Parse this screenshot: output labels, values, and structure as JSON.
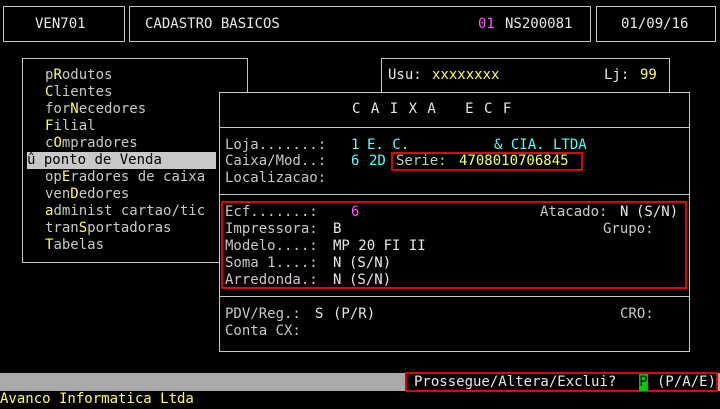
{
  "header": {
    "program_code": "VEN701",
    "title": "CADASTRO BASICOS",
    "company_num": "01",
    "workstation": "NS200081",
    "date": "01/09/16"
  },
  "userbar": {
    "user_label": "Usu:",
    "user_value": "xxxxxxxx",
    "store_label": "Lj:",
    "store_value": "99"
  },
  "menu": {
    "items": [
      {
        "pre": "p",
        "hot": "R",
        "post": "odutos"
      },
      {
        "pre": "",
        "hot": "C",
        "post": "lientes"
      },
      {
        "pre": "for",
        "hot": "N",
        "post": "ecedores"
      },
      {
        "pre": "",
        "hot": "F",
        "post": "ilial"
      },
      {
        "pre": "c",
        "hot": "O",
        "post": "mpradores"
      },
      {
        "pre": "û ",
        "hot": "p",
        "post": "onto de Venda"
      },
      {
        "pre": "op",
        "hot": "E",
        "post": "radores de caixa"
      },
      {
        "pre": "ven",
        "hot": "D",
        "post": "edores"
      },
      {
        "pre": "",
        "hot": "a",
        "post": "dminist cartao/tic"
      },
      {
        "pre": "tran",
        "hot": "S",
        "post": "portadoras"
      },
      {
        "pre": "",
        "hot": "T",
        "post": "abelas"
      }
    ]
  },
  "dialog": {
    "title": "C A I X A   E C F",
    "loja_label": "Loja.......:",
    "loja_num": "1",
    "loja_name": "E. C.",
    "loja_name2": "& CIA. LTDA",
    "caixa_label": "Caixa/Mod..:",
    "caixa_num": "6",
    "caixa_mod": "2D",
    "serie_label": "Serie:",
    "serie_value": "4708010706845",
    "localizacao_label": "Localizacao:",
    "ecf_label": "Ecf.......:",
    "ecf_value": "6",
    "atacado_label": "Atacado:",
    "atacado_value": "N",
    "atacado_hint": "(S/N)",
    "impressora_label": "Impressora:",
    "impressora_value": "B",
    "grupo_label": "Grupo:",
    "modelo_label": "Modelo....:",
    "modelo_value": "MP 20 FI II",
    "soma_label": "Soma 1....:",
    "soma_value": "N",
    "soma_hint": "(S/N)",
    "arredonda_label": "Arredonda.:",
    "arredonda_value": "N",
    "arredonda_hint": "(S/N)",
    "pdv_label": "PDV/Reg.:",
    "pdv_value": "S",
    "pdv_hint": "(P/R)",
    "cro_label": "CRO:",
    "conta_label": "Conta CX:"
  },
  "status": {
    "prompt": "Prossegue/Altera/Exclui?",
    "answer": "P",
    "hint": "(P/A/E)"
  },
  "footer": {
    "company": "Avanco Informatica Ltda"
  }
}
